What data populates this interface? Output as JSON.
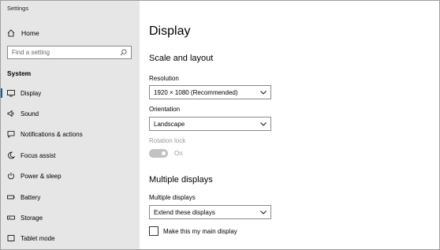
{
  "window": {
    "title": "Settings"
  },
  "sidebar": {
    "home_label": "Home",
    "search": {
      "placeholder": "Find a setting"
    },
    "section_label": "System",
    "items": [
      {
        "label": "Display",
        "icon": "monitor-icon",
        "active": true
      },
      {
        "label": "Sound",
        "icon": "speaker-icon"
      },
      {
        "label": "Notifications & actions",
        "icon": "message-icon"
      },
      {
        "label": "Focus assist",
        "icon": "moon-icon"
      },
      {
        "label": "Power & sleep",
        "icon": "power-icon"
      },
      {
        "label": "Battery",
        "icon": "battery-icon"
      },
      {
        "label": "Storage",
        "icon": "storage-icon"
      },
      {
        "label": "Tablet mode",
        "icon": "tablet-icon"
      }
    ]
  },
  "content": {
    "page_title": "Display",
    "scale_layout": {
      "heading": "Scale and layout",
      "resolution_label": "Resolution",
      "resolution_value": "1920 × 1080 (Recommended)",
      "orientation_label": "Orientation",
      "orientation_value": "Landscape",
      "rotation_lock_label": "Rotation lock",
      "rotation_lock_state": "On"
    },
    "multiple_displays": {
      "heading": "Multiple displays",
      "label": "Multiple displays",
      "value": "Extend these displays",
      "main_display_checkbox_label": "Make this my main display"
    }
  },
  "colors": {
    "accent": "#0063b1",
    "sidebar_bg": "#e6e6e6",
    "disabled_text": "#9a9a9a"
  }
}
